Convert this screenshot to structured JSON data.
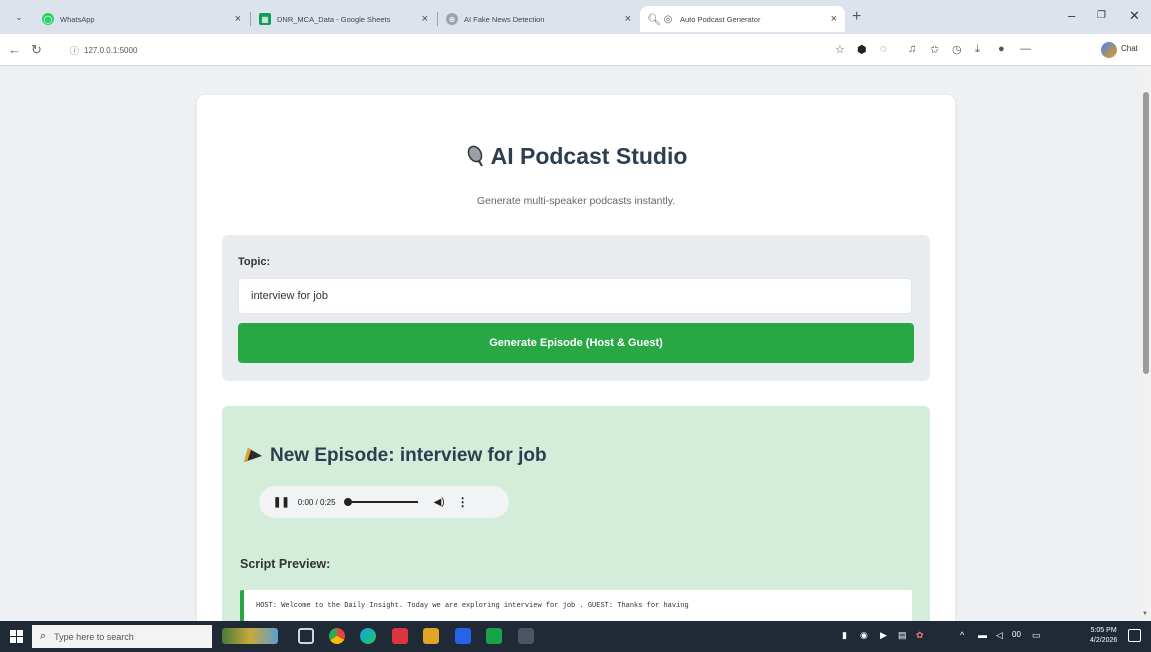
{
  "browser": {
    "tabs": [
      {
        "title": "WhatsApp",
        "close": "×"
      },
      {
        "title": "DNR_MCA_Data - Google Sheets",
        "close": "×"
      },
      {
        "title": "AI Fake News Detection",
        "close": "×"
      },
      {
        "title": "Auto Podcast Generator",
        "close": "×",
        "active": true
      }
    ],
    "new_tab": "+",
    "url": "127.0.0.1:5000",
    "profile_label": "Chat",
    "window_controls": {
      "minimize": "–",
      "restore": "❐",
      "close": "✕"
    }
  },
  "app": {
    "title": "AI Podcast Studio",
    "subtitle": "Generate multi-speaker podcasts instantly.",
    "form": {
      "topic_label": "Topic:",
      "topic_value": "interview for job",
      "generate_button": "Generate Episode (Host & Guest)"
    },
    "result": {
      "episode_title": "New Episode: interview for job",
      "audio": {
        "time": "0:00 / 0:25"
      },
      "script_label": "Script Preview:",
      "script_text": "HOST: Welcome to the Daily Insight. Today we are exploring interview for job . GUEST: Thanks for having"
    }
  },
  "taskbar": {
    "search_placeholder": "Type here to search",
    "clock_time": "5:05 PM",
    "clock_date": "4/2/2026"
  },
  "colors": {
    "accent_green": "#28a745",
    "result_bg": "#d4edda",
    "title_color": "#2c3e50"
  }
}
